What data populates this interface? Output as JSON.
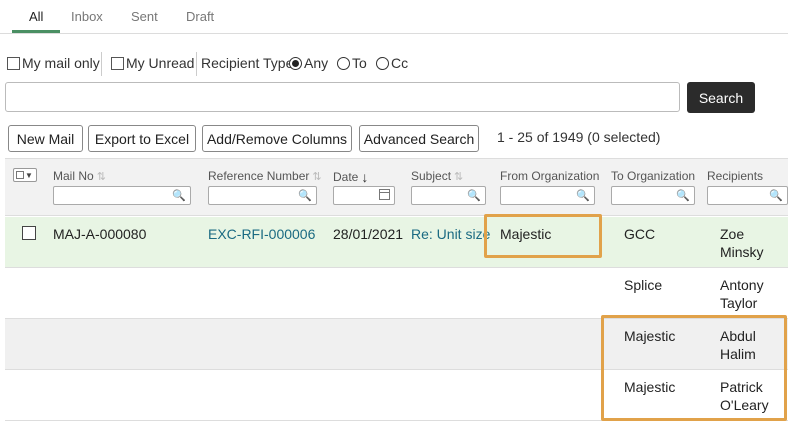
{
  "tabs": [
    "All",
    "Inbox",
    "Sent",
    "Draft"
  ],
  "filters": {
    "my_mail_only": "My mail only",
    "my_unread": "My Unread",
    "recipient_type_label": "Recipient Type",
    "recipient_types": [
      "Any",
      "To",
      "Cc"
    ],
    "recipient_type_selected": "Any"
  },
  "search": {
    "value": "",
    "button_label": "Search"
  },
  "toolbar": {
    "new_mail": "New Mail",
    "export_excel": "Export to Excel",
    "add_remove_columns": "Add/Remove Columns",
    "advanced_search": "Advanced Search",
    "result_count": "1 - 25 of 1949 (0 selected)"
  },
  "columns": [
    "Mail No",
    "Reference Number",
    "Date",
    "Subject",
    "From Organization",
    "To Organization",
    "Recipients"
  ],
  "rows": [
    {
      "mail_no": "MAJ-A-000080",
      "reference_number": "EXC-RFI-000006",
      "date": "28/01/2021",
      "subject": "Re: Unit size",
      "from_org": "Majestic",
      "to_org": "GCC",
      "recipient_first": "Zoe",
      "recipient_last": "Minsky"
    },
    {
      "mail_no": "",
      "reference_number": "",
      "date": "",
      "subject": "",
      "from_org": "",
      "to_org": "Splice",
      "recipient_first": "Antony",
      "recipient_last": "Taylor"
    },
    {
      "mail_no": "",
      "reference_number": "",
      "date": "",
      "subject": "",
      "from_org": "",
      "to_org": "Majestic",
      "recipient_first": "Abdul",
      "recipient_last": "Halim"
    },
    {
      "mail_no": "",
      "reference_number": "",
      "date": "",
      "subject": "",
      "from_org": "",
      "to_org": "Majestic",
      "recipient_first": "Patrick",
      "recipient_last": "O'Leary"
    }
  ],
  "colors": {
    "row_selected_bg": "#e8f5e4",
    "row_alt_bg": "#f0f0f0",
    "highlight_border": "#e1a24a",
    "link": "#1a6a82",
    "tab_accent": "#4a8f63"
  },
  "icons": {
    "search_filter": "magnifier-icon",
    "date_picker": "calendar-icon",
    "sort": "sort-arrows-icon"
  }
}
